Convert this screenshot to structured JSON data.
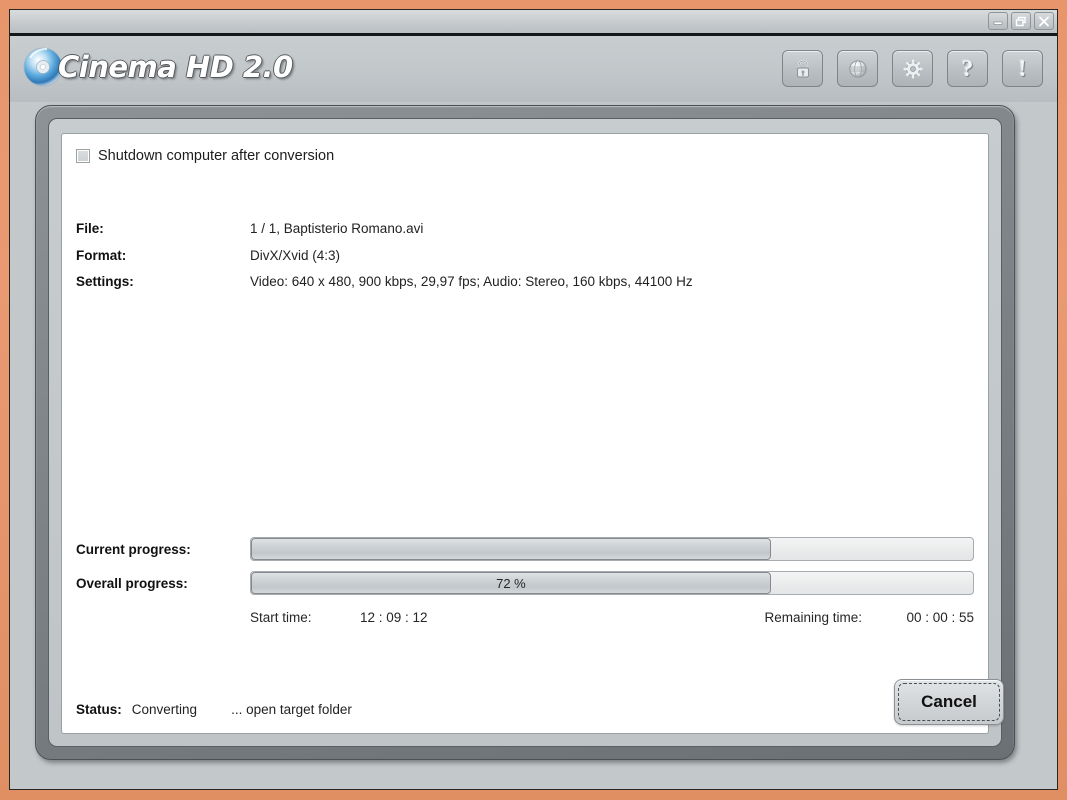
{
  "window": {
    "title": "Cinema HD 2.0",
    "controls": [
      {
        "name": "minimize-button",
        "glyph": "minimize"
      },
      {
        "name": "restore-button",
        "glyph": "restore"
      },
      {
        "name": "close-button",
        "glyph": "close"
      }
    ]
  },
  "brand": {
    "logo_text": "Cinema HD 2.0"
  },
  "toolbar": {
    "buttons": [
      {
        "name": "lock-icon",
        "label": "lock",
        "glyph": ""
      },
      {
        "name": "globe-icon",
        "label": "globe",
        "glyph": ""
      },
      {
        "name": "gear-icon",
        "label": "settings",
        "glyph": ""
      },
      {
        "name": "help-icon",
        "label": "help",
        "glyph": "?"
      },
      {
        "name": "info-icon",
        "label": "info",
        "glyph": "!"
      }
    ]
  },
  "options": {
    "shutdown_checkbox_label": "Shutdown computer after conversion",
    "shutdown_checked": false
  },
  "job": {
    "file_key": "File:",
    "file_value": "1 / 1, Baptisterio Romano.avi",
    "format_key": "Format:",
    "format_value": "DivX/Xvid (4:3)",
    "settings_key": "Settings:",
    "settings_value": "Video: 640 x 480, 900 kbps, 29,97 fps; Audio: Stereo, 160 kbps, 44100 Hz"
  },
  "progress": {
    "current_label": "Current progress:",
    "current_percent": 72,
    "current_text": "",
    "overall_label": "Overall progress:",
    "overall_percent": 72,
    "overall_text": "72 %",
    "start_time_label": "Start time:",
    "start_time_value": "12 : 09 : 12",
    "remaining_time_label": "Remaining time:",
    "remaining_time_value": "00 : 00 : 55"
  },
  "status": {
    "key": "Status:",
    "value": "Converting",
    "link": "... open target folder"
  },
  "actions": {
    "cancel_label": "Cancel"
  },
  "colors": {
    "frame": "#e8956b",
    "panel": "#c3c8cb",
    "bezel": "#7e8387",
    "content": "#ffffff",
    "progress_fill": "#ccd1d4"
  }
}
